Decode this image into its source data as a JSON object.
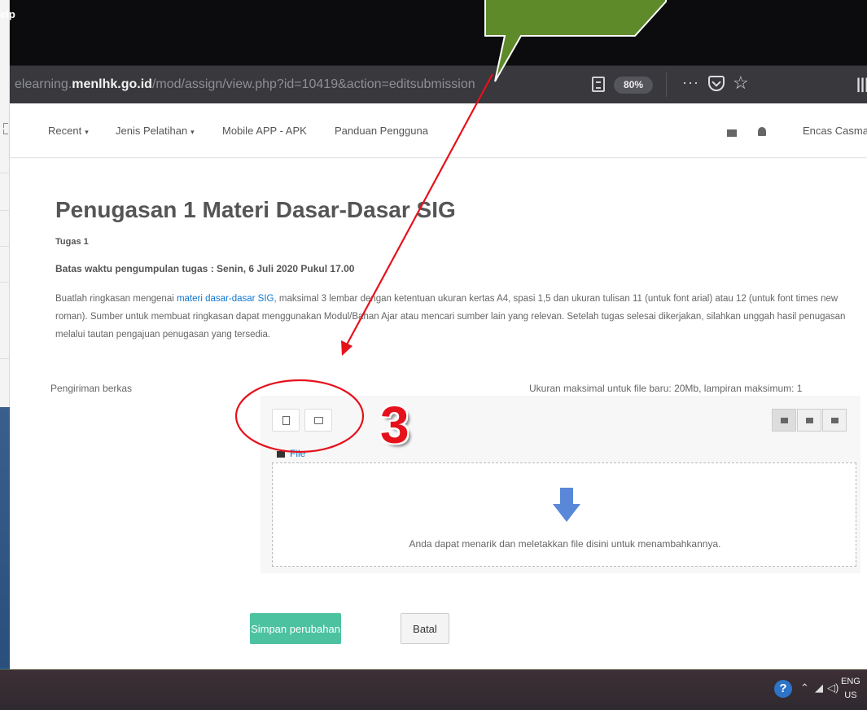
{
  "window": {
    "menu_fragment": "elp"
  },
  "address_bar": {
    "url_prefix": "elearning.",
    "url_domain": "menlhk.go.id",
    "url_path": "/mod/assign/view.php?id=10419&action=editsubmission",
    "zoom_level": "80%",
    "page_actions_label": "···"
  },
  "navbar": {
    "items": [
      {
        "label": "Recent",
        "has_dropdown": true
      },
      {
        "label": "Jenis Pelatihan",
        "has_dropdown": true
      },
      {
        "label": "Mobile APP - APK",
        "has_dropdown": false
      },
      {
        "label": "Panduan Pengguna",
        "has_dropdown": false
      }
    ],
    "user_name": "Encas Casma"
  },
  "assignment": {
    "title": "Penugasan 1 Materi Dasar-Dasar SIG",
    "subtitle": "Tugas 1",
    "deadline": "Batas waktu pengumpulan tugas : Senin, 6 Juli 2020 Pukul 17.00",
    "desc_before_link": "Buatlah ringkasan mengenai ",
    "desc_link": "materi dasar-dasar SIG",
    "desc_after_link": ", maksimal 3 lembar dengan ketentuan ukuran kertas A4,  spasi 1,5 dan ukuran tulisan 11 (untuk font arial) atau 12 (untuk font times new roman). Sumber untuk membuat ringkasan dapat menggunakan Modul/Bahan Ajar atau mencari sumber lain yang relevan. Setelah tugas selesai dikerjakan, silahkan unggah hasil penugasan melalui tautan pengajuan penugasan yang tersedia."
  },
  "file_submission": {
    "label": "Pengiriman berkas",
    "max_info": "Ukuran maksimal untuk file baru: 20Mb, lampiran maksimum: 1",
    "folder_path": "File",
    "drop_text": "Anda dapat menarik dan meletakkan file disini untuk menambahkannya."
  },
  "buttons": {
    "save": "Simpan perubahan",
    "cancel": "Batal"
  },
  "annotation": {
    "step_number": "3",
    "colors": {
      "callout_fill": "#5e8a2a",
      "annotation_red": "#e5121c"
    }
  },
  "taskbar": {
    "lang_top": "ENG",
    "lang_bottom": "US"
  },
  "colors": {
    "save_button": "#4dc2a0",
    "link": "#1177d1",
    "drop_arrow": "#5a88d8"
  }
}
